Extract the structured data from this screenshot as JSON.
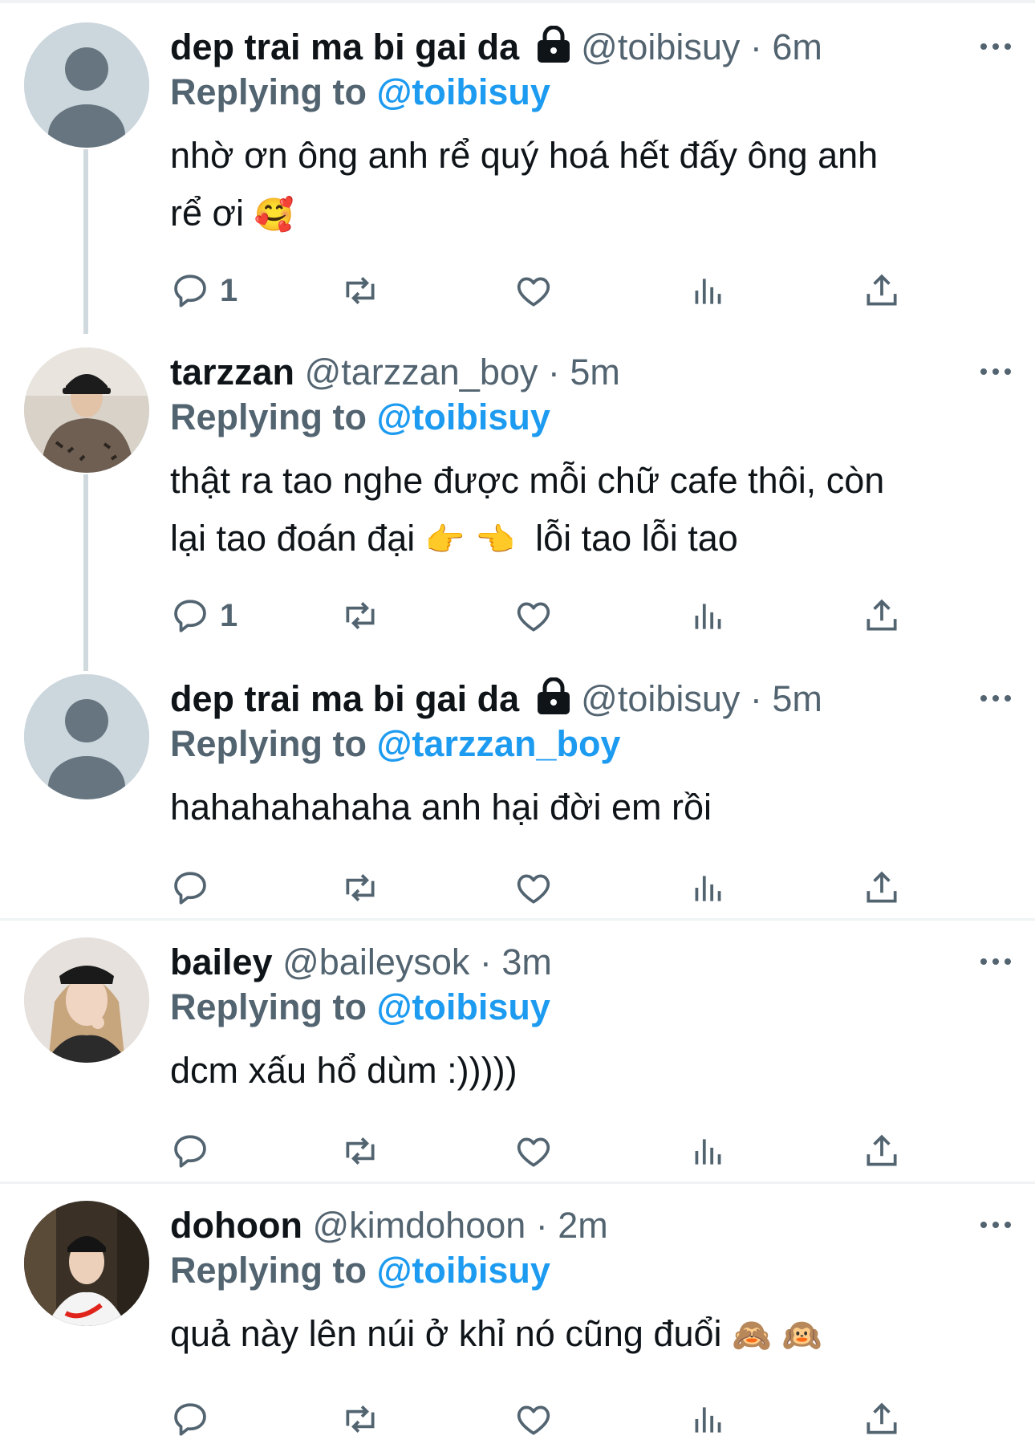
{
  "colors": {
    "accent": "#1d9bf0",
    "secondary_text": "#536471",
    "primary_text": "#0f1419",
    "thread_line": "#cfd9de",
    "divider": "#eff3f4"
  },
  "tweets": [
    {
      "name": "dep trai ma bi gai da",
      "badge_icon": "lock-icon",
      "handle": "@toibisuy",
      "dot": " · ",
      "time": "6m",
      "replying_label": "Replying to",
      "replying_handle": "@toibisuy",
      "text_line1": "nhờ ơn ông anh rể quý hoá hết đấy ông anh",
      "text_line2": "rể ơi",
      "emoji": "🥰",
      "reply_count": "1",
      "avatar": "default-avatar"
    },
    {
      "name": "tarzzan",
      "handle": "@tarzzan_boy",
      "dot": " · ",
      "time": "5m",
      "replying_label": "Replying to",
      "replying_handle": "@toibisuy",
      "text_line1": "thật ra tao nghe được mỗi chữ cafe thôi, còn",
      "text_line2_a": "lại tao đoán đại",
      "emoji": "👉 👈",
      "text_line2_b": "lỗi tao lỗi tao",
      "reply_count": "1",
      "avatar": "user-photo"
    },
    {
      "name": "dep trai ma bi gai da",
      "badge_icon": "lock-icon",
      "handle": "@toibisuy",
      "dot": " · ",
      "time": "5m",
      "replying_label": "Replying to",
      "replying_handle": "@tarzzan_boy",
      "text_line1": "hahahahahaha anh hại đời em rồi",
      "reply_count": "",
      "avatar": "default-avatar"
    },
    {
      "name": "bailey",
      "handle": "@baileysok",
      "dot": " · ",
      "time": "3m",
      "replying_label": "Replying to",
      "replying_handle": "@toibisuy",
      "text_line1": "dcm xấu hổ dùm :)))))",
      "reply_count": "",
      "avatar": "user-photo"
    },
    {
      "name": "dohoon",
      "handle": "@kimdohoon",
      "dot": " · ",
      "time": "2m",
      "replying_label": "Replying to",
      "replying_handle": "@toibisuy",
      "text_line1": "quả này lên núi ở khỉ nó cũng đuổi",
      "emoji": "🙈 🙉",
      "reply_count": "",
      "avatar": "user-photo"
    }
  ],
  "action_icons": [
    "reply-icon",
    "retweet-icon",
    "like-icon",
    "views-icon",
    "share-icon"
  ]
}
